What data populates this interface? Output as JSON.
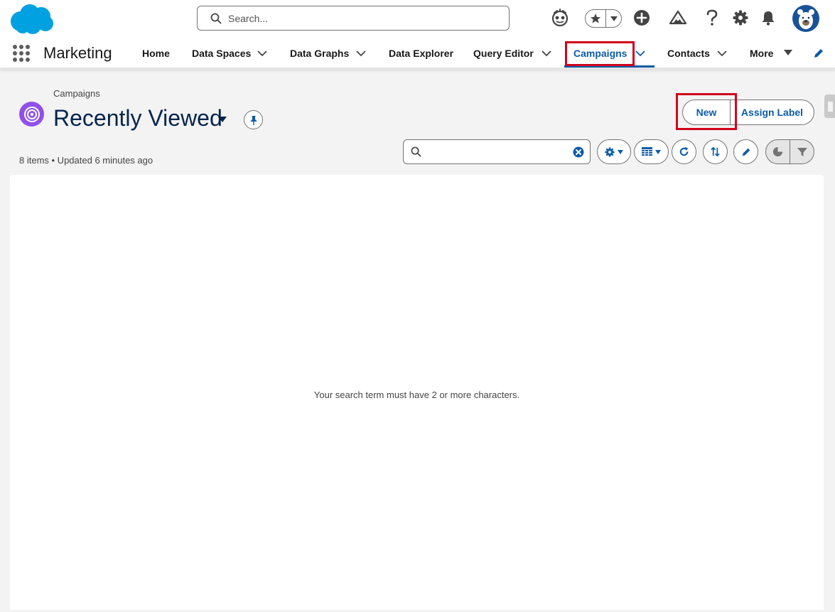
{
  "global_header": {
    "search_placeholder": "Search...",
    "icons": [
      "einstein-icon",
      "favorites-star-icon",
      "favorites-menu-icon",
      "global-actions-icon",
      "trailhead-icon",
      "help-icon",
      "setup-gear-icon",
      "notifications-bell-icon",
      "user-avatar"
    ]
  },
  "nav": {
    "app_name": "Marketing",
    "items": [
      {
        "label": "Home"
      },
      {
        "label": "Data Spaces"
      },
      {
        "label": "Data Graphs"
      },
      {
        "label": "Data Explorer"
      },
      {
        "label": "Query Editor"
      },
      {
        "label": "Campaigns",
        "active": true
      },
      {
        "label": "Contacts"
      },
      {
        "label": "More"
      }
    ]
  },
  "page": {
    "breadcrumb": "Campaigns",
    "list_view_name": "Recently Viewed",
    "meta": "8 items • Updated 6 minutes ago",
    "buttons": {
      "new": "New",
      "assign_label": "Assign Label"
    },
    "search_value": "",
    "empty_message": "Your search term must have 2 or more characters."
  },
  "colors": {
    "brand_blue": "#0b5cab",
    "campaign_icon": "#9050e9",
    "highlight_red": "#d0021b",
    "salesforce_cloud": "#00a1e0"
  }
}
